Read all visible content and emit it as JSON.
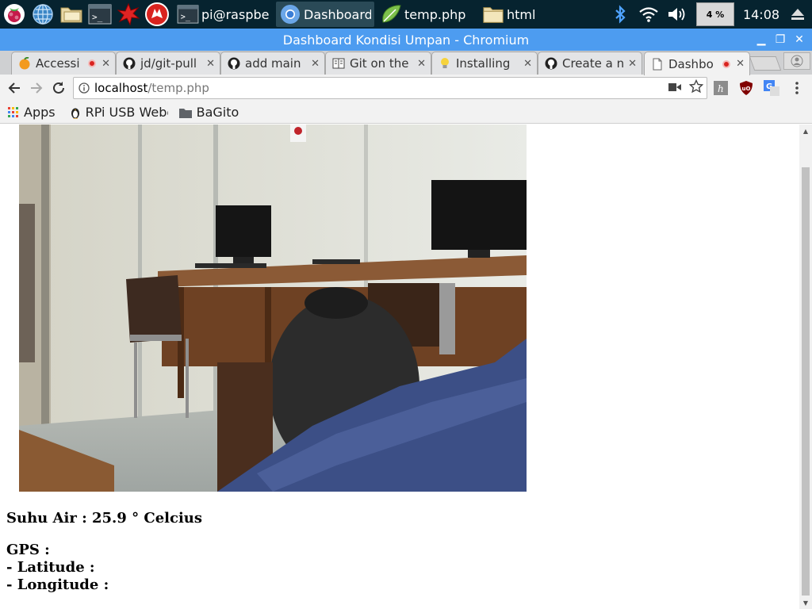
{
  "taskbar": {
    "launchers": [
      "raspberry-menu-icon",
      "web-browser-icon",
      "file-manager-icon",
      "terminal-icon",
      "math-kernel-icon",
      "wolfram-icon"
    ],
    "tasks": [
      {
        "label": "pi@raspbe…",
        "icon": "terminal-icon"
      },
      {
        "label": "Dashboard…",
        "icon": "chromium-icon"
      },
      {
        "label": "temp.php",
        "icon": "text-editor-icon"
      },
      {
        "label": "html",
        "icon": "folder-icon"
      }
    ],
    "cpu": "4 %",
    "clock": "14:08"
  },
  "window": {
    "title": "Dashboard Kondisi Umpan - Chromium"
  },
  "tabs": [
    {
      "title": "Accessi",
      "icon": "orange-icon",
      "recording": true
    },
    {
      "title": "jd/git-pull",
      "icon": "github-icon",
      "recording": false
    },
    {
      "title": "add main",
      "icon": "github-icon",
      "recording": false
    },
    {
      "title": "Git on the",
      "icon": "book-icon",
      "recording": false
    },
    {
      "title": "Installing",
      "icon": "bulb-icon",
      "recording": false
    },
    {
      "title": "Create a n",
      "icon": "github-icon",
      "recording": false
    },
    {
      "title": "Dashbo",
      "icon": "page-icon",
      "recording": true,
      "active": true
    }
  ],
  "address": {
    "host": "localhost",
    "path": "/temp.php"
  },
  "bookmarks": [
    {
      "label": "Apps",
      "icon": "apps-grid-icon"
    },
    {
      "label": "RPi USB Webca",
      "icon": "linux-penguin-icon"
    },
    {
      "label": "BaGito",
      "icon": "folder-icon"
    }
  ],
  "page": {
    "temperature_line": "Suhu Air : 25.9 ° Celcius",
    "gps_heading": "GPS :",
    "latitude_line": "- Latitude :",
    "longitude_line": "- Longitude :"
  },
  "colors": {
    "taskbar": "#06232f",
    "titlebar": "#4d9cf0",
    "tab_recording": "#d9231f"
  }
}
